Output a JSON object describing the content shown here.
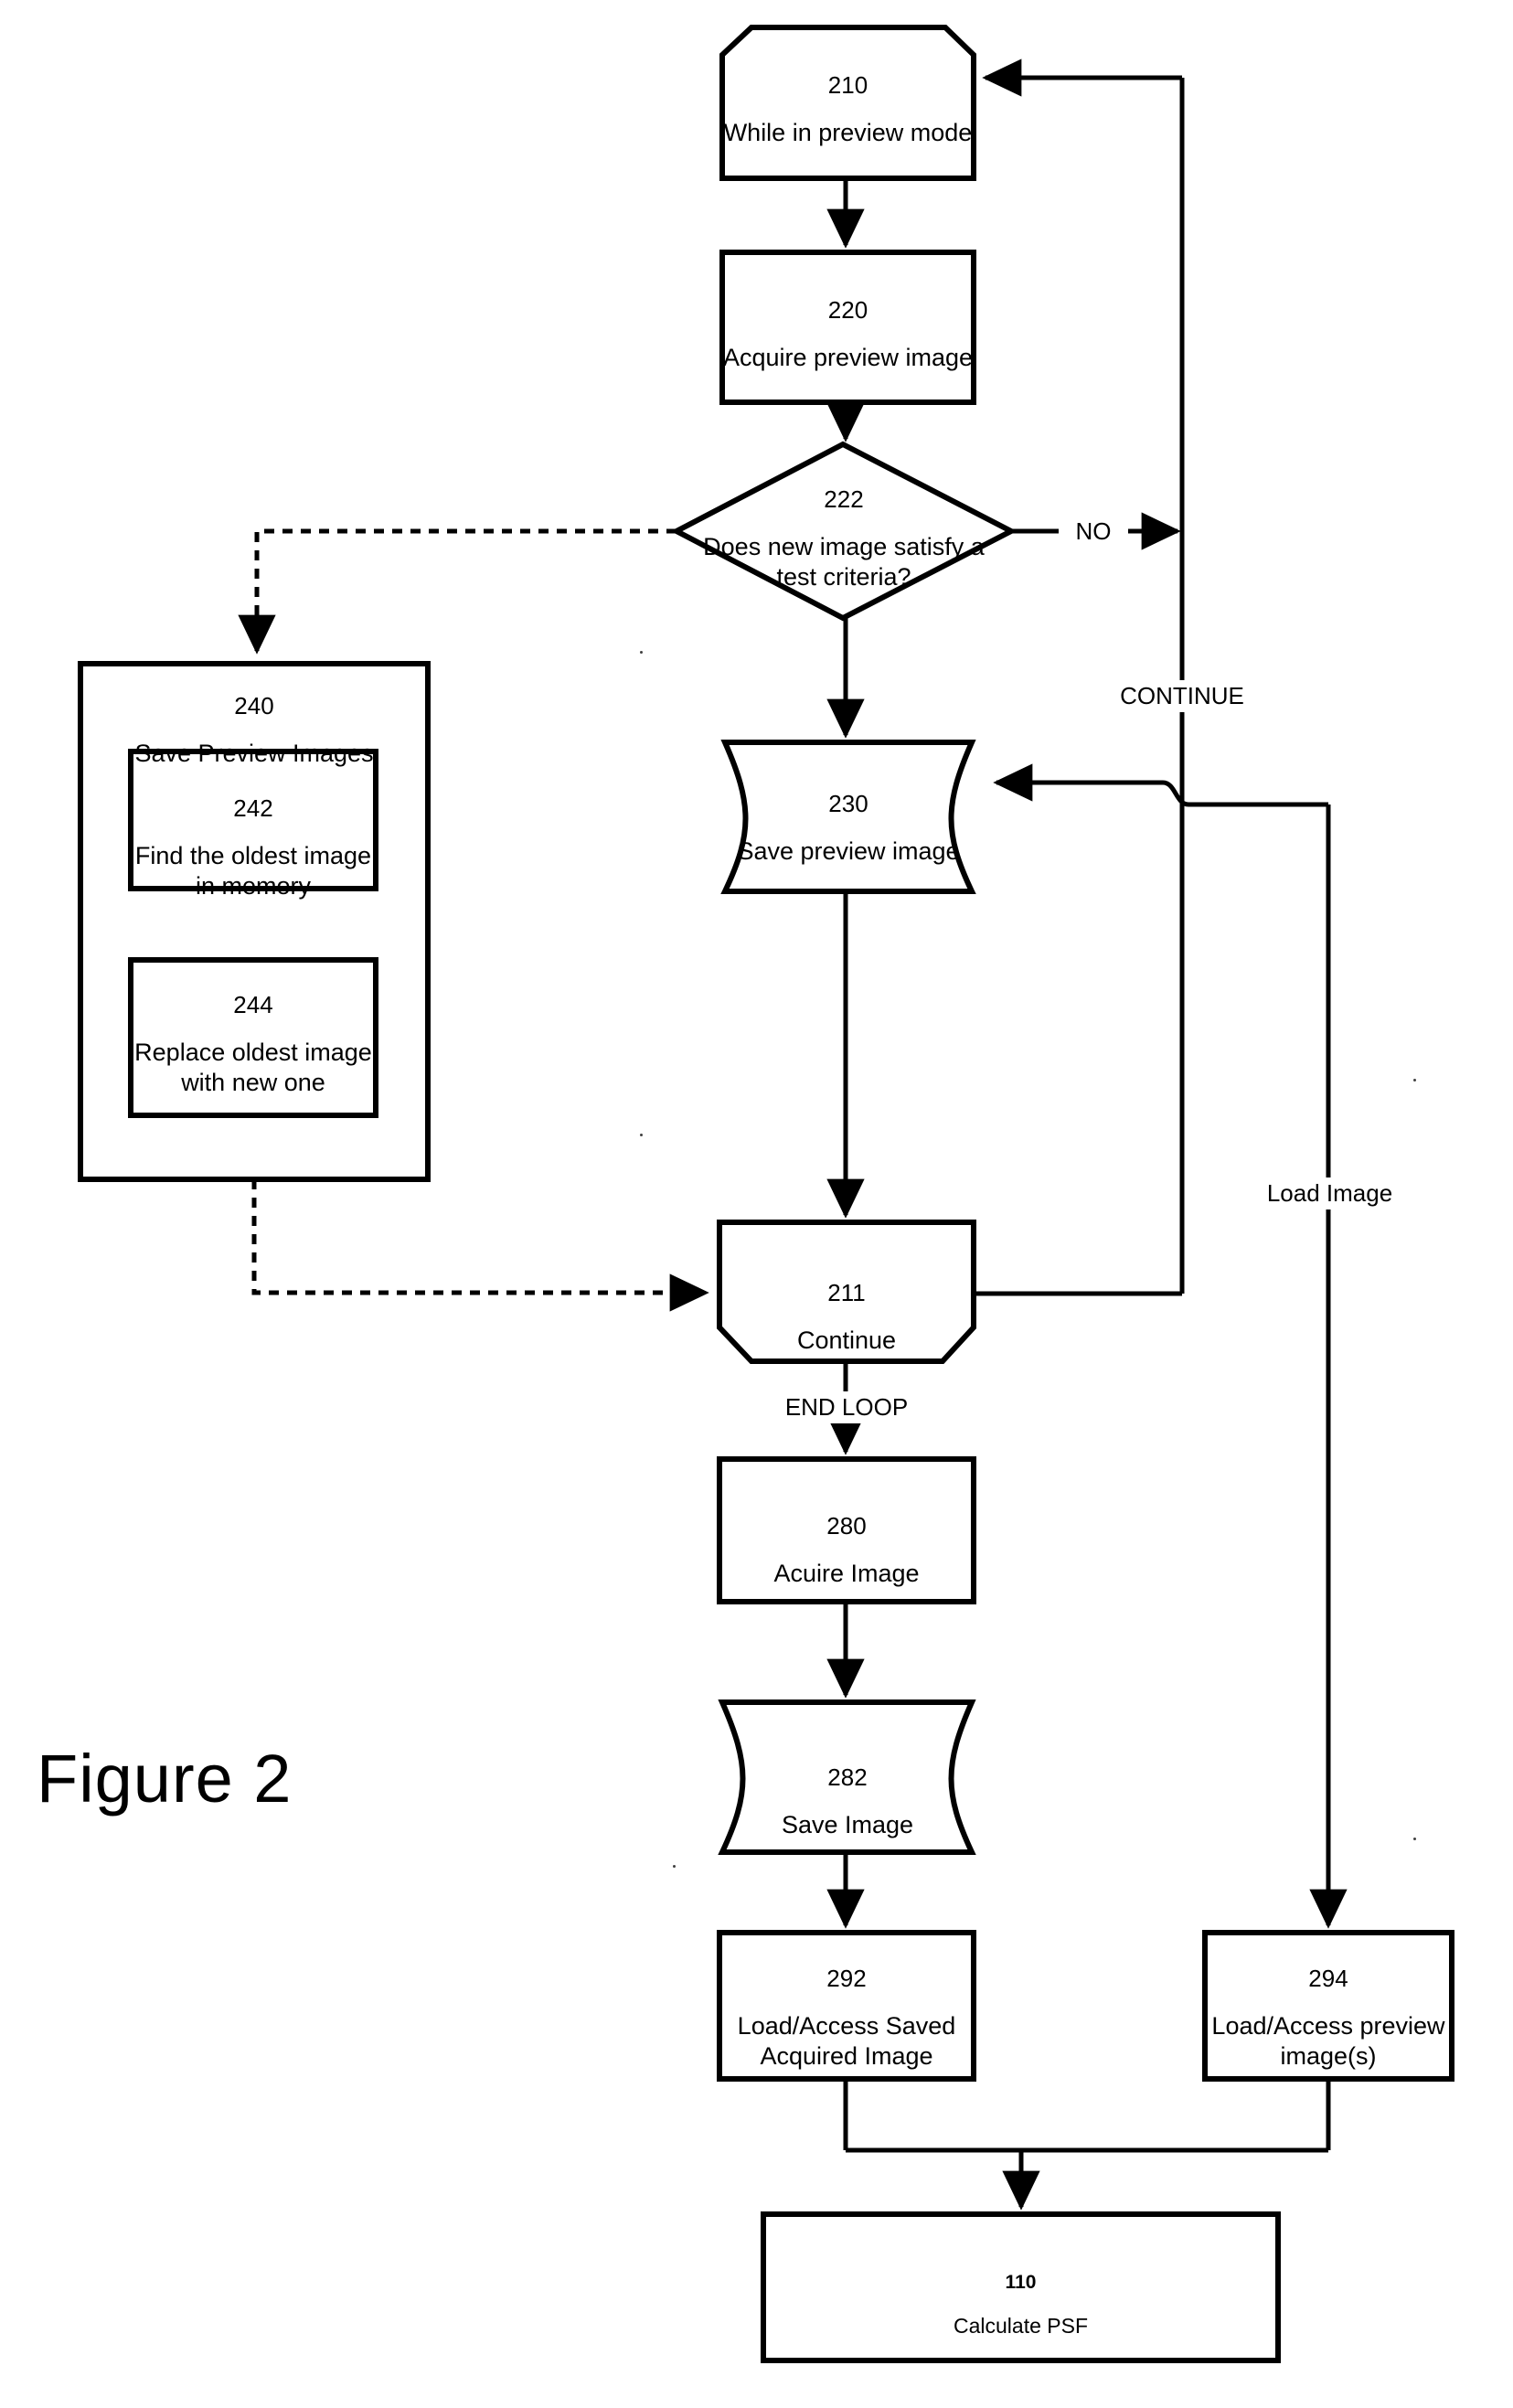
{
  "figure": {
    "caption": "Figure 2"
  },
  "nodes": [
    {
      "id": "210",
      "shape": "loop-start",
      "number": "210",
      "text": "While in preview mode"
    },
    {
      "id": "220",
      "shape": "process",
      "number": "220",
      "text": "Acquire preview image"
    },
    {
      "id": "222",
      "shape": "decision",
      "number": "222",
      "text": "Does new image satisfy a test criteria?"
    },
    {
      "id": "230",
      "shape": "stored-data",
      "number": "230",
      "text": "Save preview image"
    },
    {
      "id": "240",
      "shape": "container",
      "number": "240",
      "text": "Save Preview Images"
    },
    {
      "id": "242",
      "shape": "process",
      "number": "242",
      "text": "Find the oldest image in memory"
    },
    {
      "id": "244",
      "shape": "process",
      "number": "244",
      "text": "Replace oldest image with new one"
    },
    {
      "id": "211",
      "shape": "loop-end",
      "number": "211",
      "text": "Continue"
    },
    {
      "id": "280",
      "shape": "process",
      "number": "280",
      "text": "Acuire Image"
    },
    {
      "id": "282",
      "shape": "stored-data",
      "number": "282",
      "text": "Save Image"
    },
    {
      "id": "292",
      "shape": "process",
      "number": "292",
      "text": "Load/Access Saved Acquired Image"
    },
    {
      "id": "294",
      "shape": "process",
      "number": "294",
      "text": "Load/Access preview image(s)"
    },
    {
      "id": "110",
      "shape": "process",
      "number": "110",
      "text": "Calculate PSF"
    }
  ],
  "edge_labels": {
    "no": "NO",
    "continue": "CONTINUE",
    "end_loop": "END LOOP",
    "load_image": "Load Image"
  },
  "style": {
    "line_color": "#000000",
    "background": "#ffffff"
  }
}
